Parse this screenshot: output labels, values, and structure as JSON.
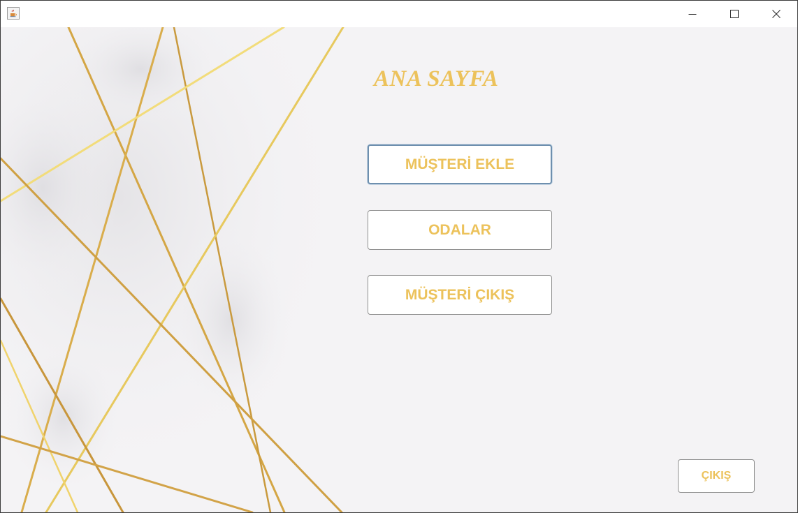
{
  "window": {
    "app_icon": "java-cup-icon",
    "controls": {
      "minimize_icon": "minimize-icon",
      "maximize_icon": "maximize-icon",
      "close_icon": "close-icon"
    }
  },
  "main": {
    "title": "ANA SAYFA",
    "buttons": {
      "add_customer": "MÜŞTERİ EKLE",
      "rooms": "ODALAR",
      "customer_checkout": "MÜŞTERİ ÇIKIŞ"
    },
    "exit_label": "ÇIKIŞ"
  },
  "colors": {
    "accent_gold": "#ecc25b",
    "background": "#f4f3f5",
    "focus_border": "#6e8fae"
  }
}
